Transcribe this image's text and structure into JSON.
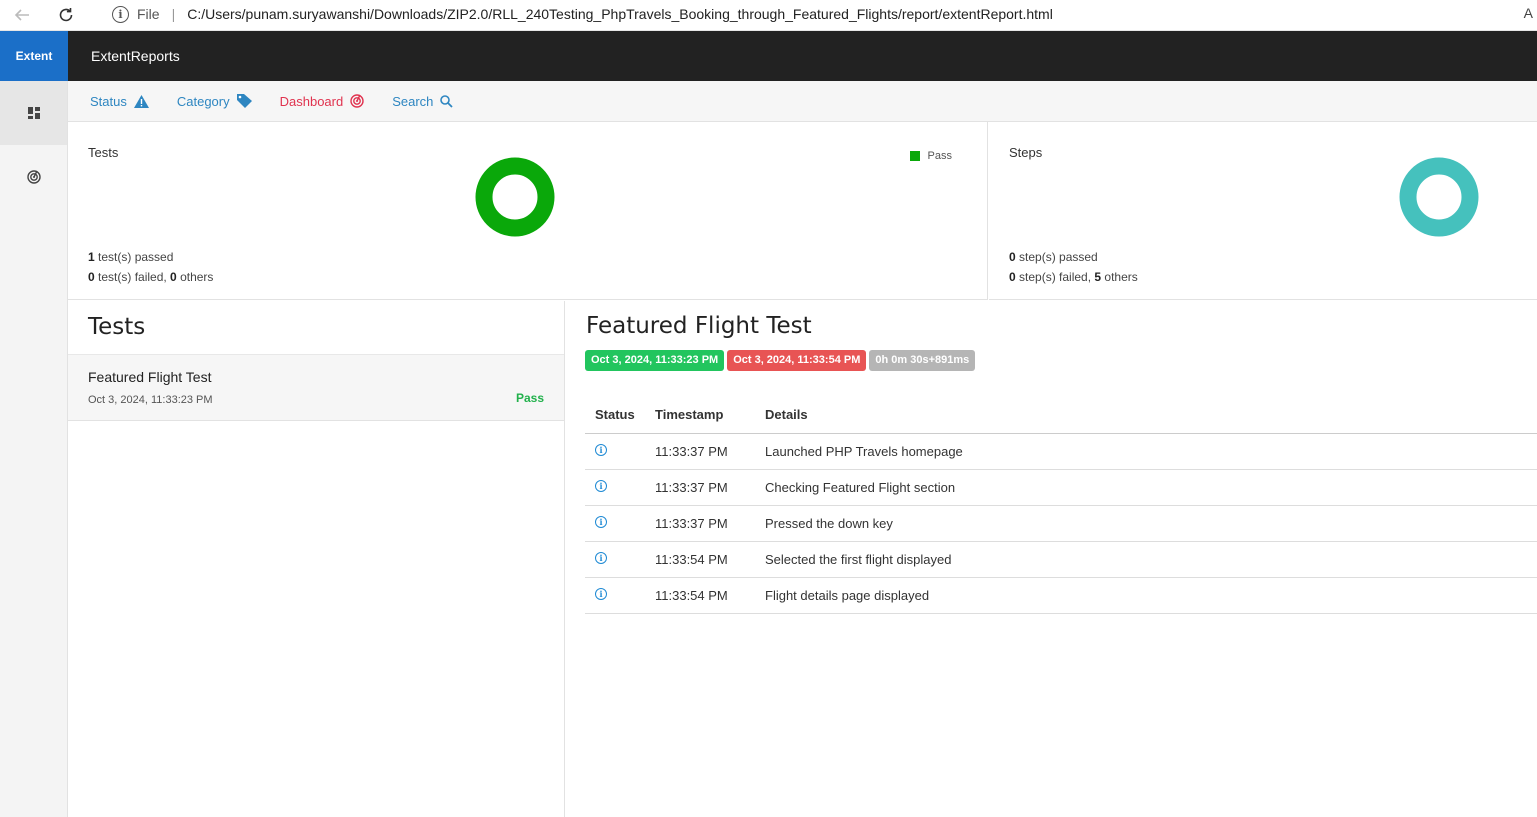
{
  "browser": {
    "scheme_label": "File",
    "url": "C:/Users/punam.suryawanshi/Downloads/ZIP2.0/RLL_240Testing_PhpTravels_Booking_through_Featured_Flights/report/extentReport.html",
    "read_aloud": "A"
  },
  "sidebar": {
    "brand": "Extent",
    "items": [
      {
        "icon": "dashboard-grid-icon",
        "active": true
      },
      {
        "icon": "target-icon",
        "active": false
      }
    ]
  },
  "header": {
    "title": "ExtentReports"
  },
  "subnav": {
    "items": [
      {
        "label": "Status",
        "icon": "warning-icon"
      },
      {
        "label": "Category",
        "icon": "tag-icon"
      },
      {
        "label": "Dashboard",
        "icon": "target-icon"
      },
      {
        "label": "Search",
        "icon": "search-icon"
      }
    ]
  },
  "dashboard": {
    "tests": {
      "title": "Tests",
      "legend": "Pass",
      "passed_count": "1",
      "passed_text": " test(s) passed",
      "failed_count": "0",
      "failed_text": " test(s) failed, ",
      "others_count": "0",
      "others_text": " others"
    },
    "steps": {
      "title": "Steps",
      "passed_count": "0",
      "passed_text": " step(s) passed",
      "failed_count": "0",
      "failed_text": " step(s) failed, ",
      "others_count": "5",
      "others_text": " others"
    },
    "colors": {
      "pass": "#0aa80a",
      "info": "#45c1bd"
    }
  },
  "tests_panel": {
    "heading": "Tests",
    "items": [
      {
        "name": "Featured Flight Test",
        "time": "Oct 3, 2024, 11:33:23 PM",
        "status": "Pass"
      }
    ]
  },
  "detail": {
    "title": "Featured Flight Test",
    "start_time": "Oct 3, 2024, 11:33:23 PM",
    "end_time": "Oct 3, 2024, 11:33:54 PM",
    "duration": "0h 0m 30s+891ms",
    "columns": [
      "Status",
      "Timestamp",
      "Details"
    ],
    "rows": [
      {
        "status": "info",
        "timestamp": "11:33:37 PM",
        "details": "Launched PHP Travels homepage"
      },
      {
        "status": "info",
        "timestamp": "11:33:37 PM",
        "details": "Checking Featured Flight section"
      },
      {
        "status": "info",
        "timestamp": "11:33:37 PM",
        "details": "Pressed the down key"
      },
      {
        "status": "info",
        "timestamp": "11:33:54 PM",
        "details": "Selected the first flight displayed"
      },
      {
        "status": "info",
        "timestamp": "11:33:54 PM",
        "details": "Flight details page displayed"
      }
    ]
  }
}
